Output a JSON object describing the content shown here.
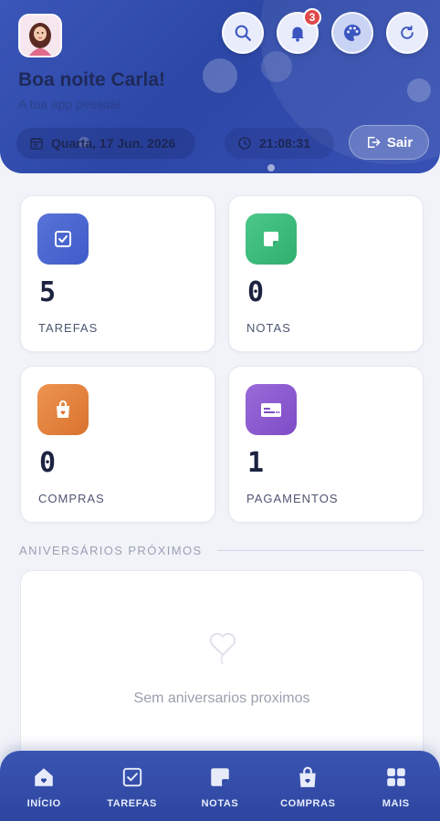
{
  "header": {
    "greeting": "Boa noite Carla!",
    "subtitle": "A tua app pessoal",
    "date": "Quarta, 17 Jun. 2026",
    "time": "21:08:31",
    "logout_label": "Sair",
    "notification_count": "3"
  },
  "stats": [
    {
      "value": "5",
      "label": "TAREFAS",
      "icon": "check-square-icon",
      "color": "#4a66cf"
    },
    {
      "value": "0",
      "label": "NOTAS",
      "icon": "note-icon",
      "color": "#3bbb7b"
    },
    {
      "value": "0",
      "label": "COMPRAS",
      "icon": "shopping-bag-icon",
      "color": "#e3843f"
    },
    {
      "value": "1",
      "label": "PAGAMENTOS",
      "icon": "payment-card-icon",
      "color": "#8b5bd0"
    }
  ],
  "birthdays": {
    "title": "ANIVERSÁRIOS PRÓXIMOS",
    "empty_text": "Sem aniversarios proximos"
  },
  "nav": [
    {
      "label": "INÍCIO",
      "icon": "home-icon"
    },
    {
      "label": "TAREFAS",
      "icon": "check-square-icon"
    },
    {
      "label": "NOTAS",
      "icon": "note-icon"
    },
    {
      "label": "COMPRAS",
      "icon": "shopping-bag-icon"
    },
    {
      "label": "MAIS",
      "icon": "grid-icon"
    }
  ]
}
